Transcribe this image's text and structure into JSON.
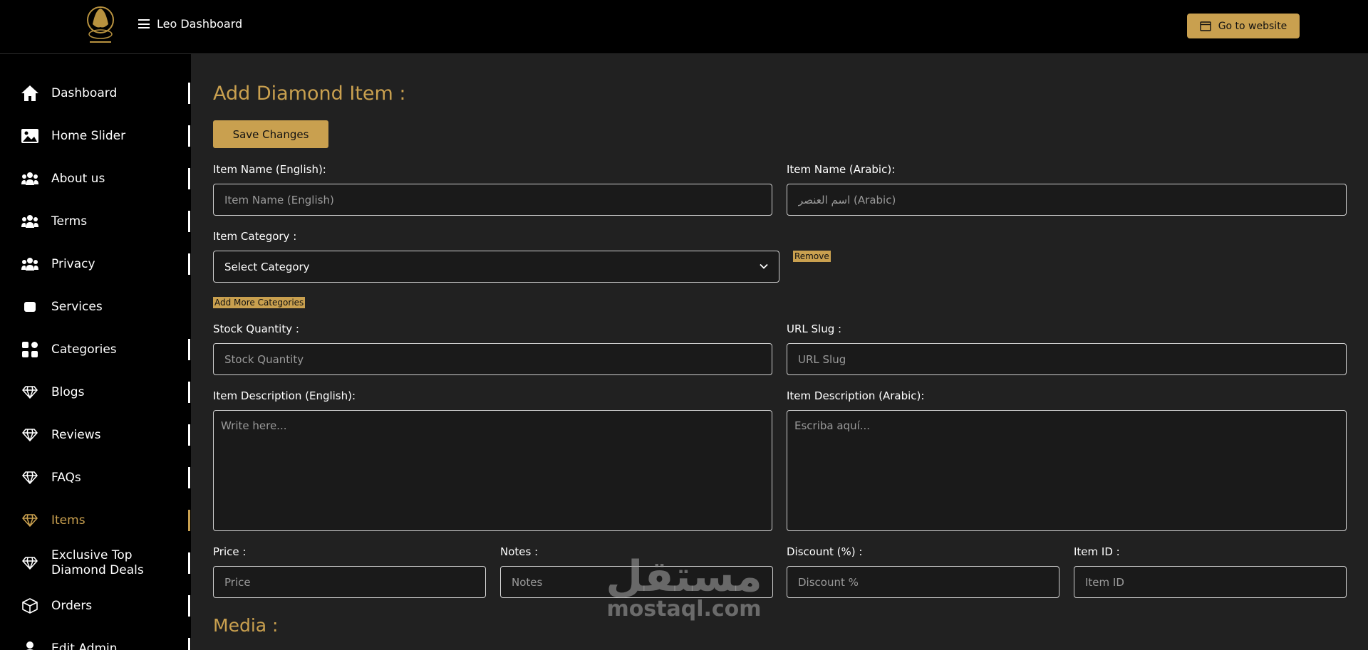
{
  "header": {
    "app_title": "Leo Dashboard",
    "go_to_website": "Go to website"
  },
  "sidebar": {
    "items": [
      {
        "label": "Dashboard",
        "icon": "home-icon"
      },
      {
        "label": "Home Slider",
        "icon": "image-icon"
      },
      {
        "label": "About us",
        "icon": "users-icon"
      },
      {
        "label": "Terms",
        "icon": "users-icon"
      },
      {
        "label": "Privacy",
        "icon": "users-icon"
      },
      {
        "label": "Services",
        "icon": "square-icon"
      },
      {
        "label": "Categories",
        "icon": "grid-icon"
      },
      {
        "label": "Blogs",
        "icon": "diamond-icon"
      },
      {
        "label": "Reviews",
        "icon": "diamond-icon"
      },
      {
        "label": "FAQs",
        "icon": "diamond-icon"
      },
      {
        "label": "Items",
        "icon": "diamond-icon",
        "active": true
      },
      {
        "label": "Exclusive Top Diamond Deals",
        "icon": "diamond-icon"
      },
      {
        "label": "Orders",
        "icon": "box-icon"
      },
      {
        "label": "Edit Admin",
        "icon": "user-icon"
      }
    ]
  },
  "form": {
    "title": "Add Diamond Item :",
    "save_label": "Save Changes",
    "name_en_label": "Item Name (English):",
    "name_en_placeholder": "Item Name (English)",
    "name_ar_label": "Item Name (Arabic):",
    "name_ar_placeholder": "اسم العنصر (Arabic)",
    "category_label": "Item Category :",
    "category_value": "Select Category",
    "remove_label": "Remove",
    "add_more_categories": "Add More Categories",
    "stock_label": "Stock Quantity :",
    "stock_placeholder": "Stock Quantity",
    "slug_label": "URL Slug :",
    "slug_placeholder": "URL Slug",
    "desc_en_label": "Item Description (English):",
    "desc_en_placeholder": "Write here...",
    "desc_ar_label": "Item Description (Arabic):",
    "desc_ar_placeholder": "Escriba aquí...",
    "price_label": "Price :",
    "price_placeholder": "Price",
    "notes_label": "Notes :",
    "notes_placeholder": "Notes",
    "discount_label": "Discount (%) :",
    "discount_placeholder": "Discount %",
    "item_id_label": "Item ID :",
    "item_id_placeholder": "Item ID",
    "media_title": "Media :"
  },
  "watermark": {
    "arabic": "مستقل",
    "latin": "mostaql.com"
  },
  "colors": {
    "accent": "#c9a04f",
    "background": "#212121",
    "sidebar": "#000000"
  }
}
